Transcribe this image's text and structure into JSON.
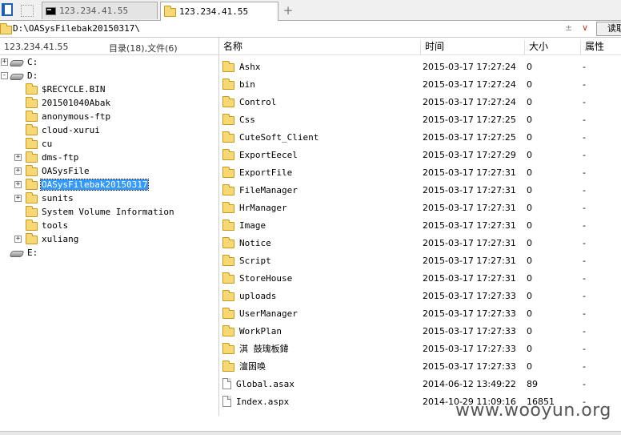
{
  "tabs": [
    {
      "label": "123.234.41.55",
      "active": false
    },
    {
      "label": "123.234.41.55",
      "active": true
    }
  ],
  "new_tab_symbol": "+",
  "path": {
    "value": "D:\\OASysFilebak20150317\\",
    "controls": "±",
    "dropdown_symbol": "∨",
    "read_button": "读取"
  },
  "left_header": {
    "host": "123.234.41.55",
    "counts": "目录(18),文件(6)"
  },
  "tree": [
    {
      "label": "C:",
      "type": "drive",
      "level": 0,
      "expander": "+"
    },
    {
      "label": "D:",
      "type": "drive",
      "level": 0,
      "expander": "-"
    },
    {
      "label": "$RECYCLE.BIN",
      "type": "folder",
      "level": 1,
      "expander": ""
    },
    {
      "label": "201501040Abak",
      "type": "folder",
      "level": 1,
      "expander": ""
    },
    {
      "label": "anonymous-ftp",
      "type": "folder",
      "level": 1,
      "expander": ""
    },
    {
      "label": "cloud-xurui",
      "type": "folder",
      "level": 1,
      "expander": ""
    },
    {
      "label": "cu",
      "type": "folder",
      "level": 1,
      "expander": ""
    },
    {
      "label": "dms-ftp",
      "type": "folder",
      "level": 1,
      "expander": "+"
    },
    {
      "label": "OASysFile",
      "type": "folder",
      "level": 1,
      "expander": "+"
    },
    {
      "label": "OASysFilebak20150317",
      "type": "folder",
      "level": 1,
      "expander": "+",
      "selected": true
    },
    {
      "label": "sunits",
      "type": "folder",
      "level": 1,
      "expander": "+"
    },
    {
      "label": "System Volume Information",
      "type": "folder",
      "level": 1,
      "expander": ""
    },
    {
      "label": "tools",
      "type": "folder",
      "level": 1,
      "expander": ""
    },
    {
      "label": "xuliang",
      "type": "folder",
      "level": 1,
      "expander": "+"
    },
    {
      "label": "E:",
      "type": "drive",
      "level": 0,
      "expander": ""
    }
  ],
  "columns": {
    "name": "名称",
    "time": "时间",
    "size": "大小",
    "attr": "属性"
  },
  "files": [
    {
      "name": "Ashx",
      "type": "folder",
      "time": "2015-03-17 17:27:24",
      "size": "0",
      "attr": "-"
    },
    {
      "name": "bin",
      "type": "folder",
      "time": "2015-03-17 17:27:24",
      "size": "0",
      "attr": "-"
    },
    {
      "name": "Control",
      "type": "folder",
      "time": "2015-03-17 17:27:24",
      "size": "0",
      "attr": "-"
    },
    {
      "name": "Css",
      "type": "folder",
      "time": "2015-03-17 17:27:25",
      "size": "0",
      "attr": "-"
    },
    {
      "name": "CuteSoft_Client",
      "type": "folder",
      "time": "2015-03-17 17:27:25",
      "size": "0",
      "attr": "-"
    },
    {
      "name": "ExportEecel",
      "type": "folder",
      "time": "2015-03-17 17:27:29",
      "size": "0",
      "attr": "-"
    },
    {
      "name": "ExportFile",
      "type": "folder",
      "time": "2015-03-17 17:27:31",
      "size": "0",
      "attr": "-"
    },
    {
      "name": "FileManager",
      "type": "folder",
      "time": "2015-03-17 17:27:31",
      "size": "0",
      "attr": "-"
    },
    {
      "name": "HrManager",
      "type": "folder",
      "time": "2015-03-17 17:27:31",
      "size": "0",
      "attr": "-"
    },
    {
      "name": "Image",
      "type": "folder",
      "time": "2015-03-17 17:27:31",
      "size": "0",
      "attr": "-"
    },
    {
      "name": "Notice",
      "type": "folder",
      "time": "2015-03-17 17:27:31",
      "size": "0",
      "attr": "-"
    },
    {
      "name": "Script",
      "type": "folder",
      "time": "2015-03-17 17:27:31",
      "size": "0",
      "attr": "-"
    },
    {
      "name": "StoreHouse",
      "type": "folder",
      "time": "2015-03-17 17:27:31",
      "size": "0",
      "attr": "-"
    },
    {
      "name": "uploads",
      "type": "folder",
      "time": "2015-03-17 17:27:33",
      "size": "0",
      "attr": "-"
    },
    {
      "name": "UserManager",
      "type": "folder",
      "time": "2015-03-17 17:27:33",
      "size": "0",
      "attr": "-"
    },
    {
      "name": "WorkPlan",
      "type": "folder",
      "time": "2015-03-17 17:27:33",
      "size": "0",
      "attr": "-"
    },
    {
      "name": "淇  鼓瑰板鍏",
      "type": "folder",
      "time": "2015-03-17 17:27:33",
      "size": "0",
      "attr": "-"
    },
    {
      "name": "澶囦唤",
      "type": "folder",
      "time": "2015-03-17 17:27:33",
      "size": "0",
      "attr": "-"
    },
    {
      "name": "Global.asax",
      "type": "file",
      "time": "2014-06-12 13:49:22",
      "size": "89",
      "attr": "-"
    },
    {
      "name": "Index.aspx",
      "type": "file",
      "time": "2014-10-29 11:09:16",
      "size": "16851",
      "attr": "-"
    }
  ],
  "watermark": "www.wooyun.org",
  "colors": {
    "selection": "#3399ff",
    "folder": "#f8d775",
    "window_icon": "#1d5fb5"
  },
  "icons": {
    "window": "window-icon",
    "terminal": "terminal-icon",
    "folder": "folder-icon",
    "file": "file-icon",
    "drive": "drive-icon"
  }
}
